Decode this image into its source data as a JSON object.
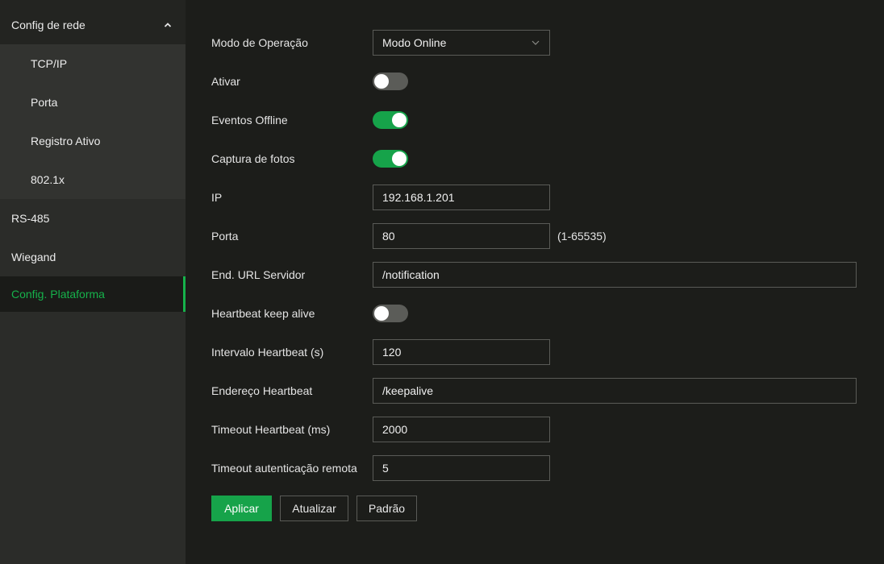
{
  "colors": {
    "accent": "#16a34a",
    "active_text": "#16b24b",
    "sidebar_bg": "#2b2c29",
    "main_bg": "#1c1d1a"
  },
  "sidebar": {
    "group": {
      "label": "Config de rede",
      "icon": "chevron-up-icon",
      "expanded": true
    },
    "subitems": [
      {
        "label": "TCP/IP"
      },
      {
        "label": "Porta"
      },
      {
        "label": "Registro Ativo"
      },
      {
        "label": "802.1x"
      }
    ],
    "items": [
      {
        "label": "RS-485"
      },
      {
        "label": "Wiegand"
      },
      {
        "label": "Config. Plataforma",
        "active": true
      }
    ]
  },
  "form": {
    "modo_operacao": {
      "label": "Modo de Operação",
      "value": "Modo Online",
      "icon": "chevron-down-icon"
    },
    "ativar": {
      "label": "Ativar",
      "on": false
    },
    "eventos_offline": {
      "label": "Eventos Offline",
      "on": true
    },
    "captura_fotos": {
      "label": "Captura de fotos",
      "on": true
    },
    "ip": {
      "label": "IP",
      "value": "192.168.1.201"
    },
    "porta": {
      "label": "Porta",
      "value": "80",
      "hint": "(1-65535)"
    },
    "url_servidor": {
      "label": "End. URL Servidor",
      "value": "/notification"
    },
    "heartbeat_keep_alive": {
      "label": "Heartbeat keep alive",
      "on": false
    },
    "intervalo_heartbeat": {
      "label": "Intervalo Heartbeat (s)",
      "value": "120"
    },
    "endereco_heartbeat": {
      "label": "Endereço Heartbeat",
      "value": "/keepalive"
    },
    "timeout_heartbeat": {
      "label": "Timeout Heartbeat (ms)",
      "value": "2000"
    },
    "timeout_autenticacao": {
      "label": "Timeout autenticação remota",
      "value": "5"
    }
  },
  "buttons": {
    "apply": "Aplicar",
    "refresh": "Atualizar",
    "default": "Padrão"
  }
}
